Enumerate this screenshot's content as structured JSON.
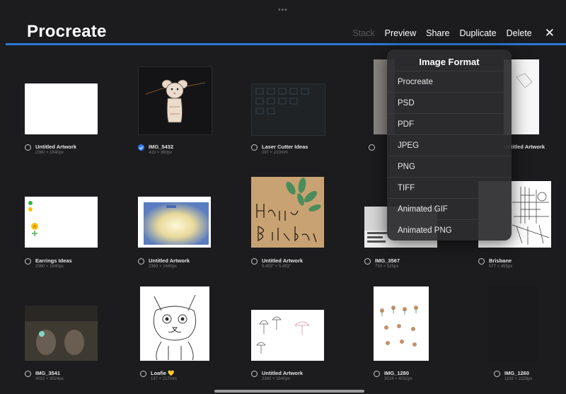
{
  "header": {
    "title": "Procreate",
    "dots": "•••",
    "toolbar": {
      "stack": "Stack",
      "preview": "Preview",
      "share": "Share",
      "duplicate": "Duplicate",
      "delete": "Delete",
      "close": "✕"
    }
  },
  "gallery": [
    {
      "name": "Untitled Artwork",
      "dims": "2360 × 1640px",
      "selected": false
    },
    {
      "name": "IMG_5432",
      "dims": "413 × 360px",
      "selected": true
    },
    {
      "name": "Laser Cutter Ideas",
      "dims": "297 × 210mm",
      "selected": false
    },
    {
      "name": "",
      "dims": "",
      "selected": false
    },
    {
      "name": "Untitled Artwork",
      "dims": "",
      "selected": false
    },
    {
      "name": "Earrings Ideas",
      "dims": "2360 × 1640px",
      "selected": false
    },
    {
      "name": "Untitled Artwork",
      "dims": "2360 × 1640px",
      "selected": false
    },
    {
      "name": "Untitled Artwork",
      "dims": "5.453\" × 5.453\"",
      "selected": false
    },
    {
      "name": "IMG_3567",
      "dims": "750 × 525px",
      "selected": false
    },
    {
      "name": "Brisbane",
      "dims": "577 × 455px",
      "selected": false
    },
    {
      "name": "IMG_3541",
      "dims": "4032 × 3024px",
      "selected": false
    },
    {
      "name": "Loafie 💛",
      "dims": "197 × 217mm",
      "selected": false
    },
    {
      "name": "Untitled Artwork",
      "dims": "2360 × 1640px",
      "selected": false
    },
    {
      "name": "IMG_1280",
      "dims": "3024 × 4032px",
      "selected": false
    },
    {
      "name": "IMG_1260",
      "dims": "1192 × 2158px",
      "selected": false
    }
  ],
  "share_menu": {
    "title": "Image Format",
    "items": [
      "Procreate",
      "PSD",
      "PDF",
      "JPEG",
      "PNG",
      "TIFF",
      "Animated GIF",
      "Animated PNG"
    ]
  },
  "colors": {
    "accent": "#2a78d6",
    "background": "#1c1c1e",
    "checkbox_selected": "#2f7bf5"
  }
}
